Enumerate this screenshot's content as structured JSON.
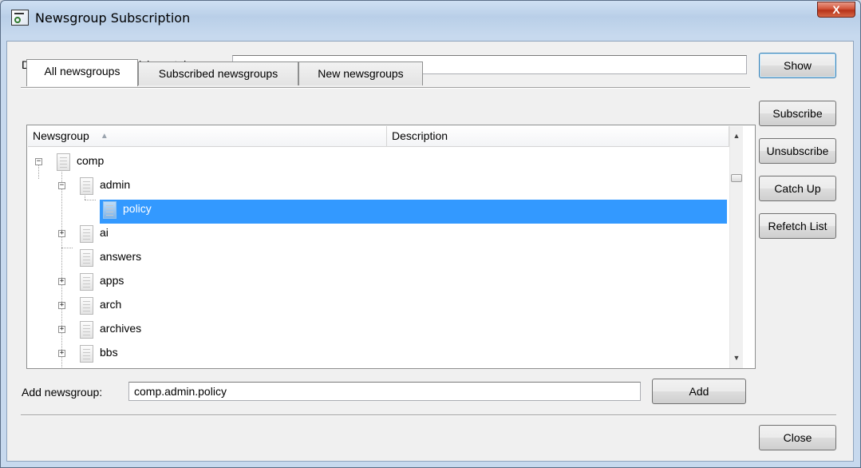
{
  "window": {
    "title": "Newsgroup Subscription",
    "close_label": "X",
    "icon": "newsgroup-app-icon"
  },
  "filter": {
    "label": "Display newsgroups which contain:",
    "value": "",
    "show_label": "Show"
  },
  "tabs": [
    {
      "label": "All newsgroups",
      "active": true
    },
    {
      "label": "Subscribed newsgroups",
      "active": false
    },
    {
      "label": "New newsgroups",
      "active": false
    }
  ],
  "columns": {
    "newsgroup": "Newsgroup",
    "description": "Description"
  },
  "tree": [
    {
      "label": "comp",
      "expander": "−"
    },
    {
      "label": "admin",
      "expander": "−"
    },
    {
      "label": "policy",
      "expander": "",
      "selected": true
    },
    {
      "label": "ai",
      "expander": "+"
    },
    {
      "label": "answers",
      "expander": ""
    },
    {
      "label": "apps",
      "expander": "+"
    },
    {
      "label": "arch",
      "expander": "+"
    },
    {
      "label": "archives",
      "expander": "+"
    },
    {
      "label": "bbs",
      "expander": "+"
    }
  ],
  "side_buttons": {
    "subscribe": "Subscribe",
    "unsubscribe": "Unsubscribe",
    "catch_up": "Catch Up",
    "refetch": "Refetch List"
  },
  "add": {
    "label": "Add newsgroup:",
    "value": "comp.admin.policy",
    "button": "Add"
  },
  "close_button": "Close",
  "colors": {
    "selection": "#3399ff",
    "close_red": "#c7452c"
  }
}
